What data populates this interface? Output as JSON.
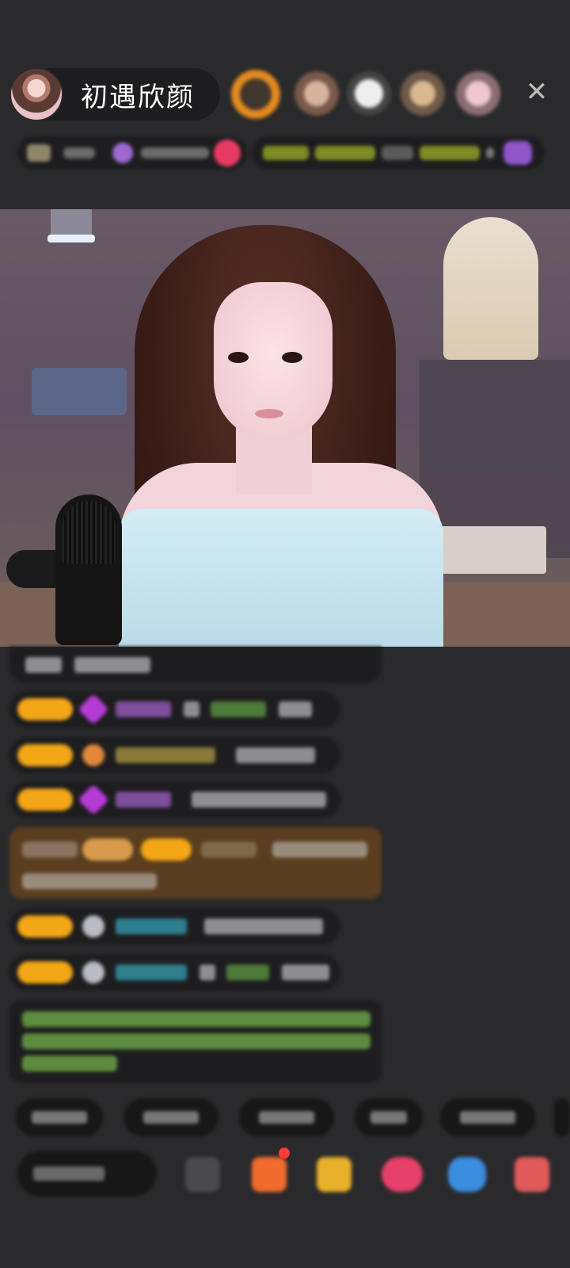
{
  "header": {
    "host_name": "初遇欣颜",
    "close_label": "✕"
  },
  "icons": {
    "close": "close-icon",
    "avatar": "host-avatar",
    "gift": "gift-icon",
    "emoji": "emoji-icon"
  },
  "bottom": {
    "quick_replies": [
      "",
      "",
      "",
      "",
      ""
    ],
    "input_placeholder": ""
  },
  "colors": {
    "background": "#2a2a2c",
    "level_badge": "#f3a616",
    "chat_bubble": "#1d1d1f",
    "green_text": "#6fbf55",
    "cyan_text": "#3fb8c6",
    "yellow_text": "#d7b24a"
  }
}
